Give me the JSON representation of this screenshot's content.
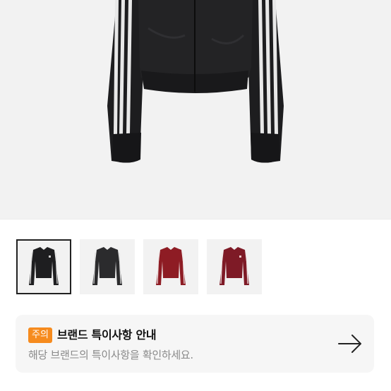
{
  "product": {
    "main_image_icon": "black-track-jacket-image",
    "thumbnails": [
      {
        "icon": "black-track-jacket-thumb",
        "color": "#1e1e20",
        "selected": true
      },
      {
        "icon": "black-track-jacket-thumb-alt",
        "color": "#2b2b2d",
        "selected": false
      },
      {
        "icon": "burgundy-track-jacket-thumb",
        "color": "#8e1c24",
        "selected": false
      },
      {
        "icon": "burgundy-track-jacket-thumb-alt",
        "color": "#7e1a26",
        "selected": false
      }
    ]
  },
  "notice": {
    "badge": "주의",
    "title": "브랜드 특이사항 안내",
    "description": "해당 브랜드의 특이사항을 확인하세요.",
    "accent_color": "#f68b1e",
    "arrow_icon": "arrow-right-icon"
  }
}
